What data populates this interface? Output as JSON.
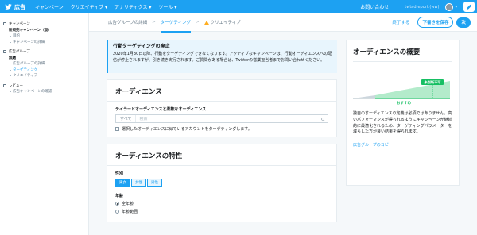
{
  "topnav": {
    "brand": "広告",
    "items": [
      "キャンペーン",
      "クリエイティブ ▾",
      "アナリティクス ▾",
      "ツール ▾"
    ],
    "contact": "お問い合わせ",
    "account": "twtadreport (ww)",
    "caret": "▾"
  },
  "sidebar": {
    "campaign_section": "キャンペーン",
    "campaign_name": "新規売キャンペーン（仮）",
    "campaign_subs": [
      "目的",
      "キャンペーンの詳細"
    ],
    "adgroup_section": "広告グループ",
    "adgroup_name": "無題",
    "adgroup_subs": [
      "広告グループの詳細",
      "ターゲティング",
      "クリエイティブ"
    ],
    "review_section": "レビュー",
    "review_sub": "広告キャンペーンの確認"
  },
  "header": {
    "breadcrumb": "広告グループの詳細",
    "sep": ">",
    "tab_active": "ターゲティング",
    "tab_warn": "クリエイティブ",
    "cancel": "終了する",
    "save": "下書きを保存",
    "next": "次"
  },
  "notice": {
    "title": "行動ターゲティングの廃止",
    "body": "2020年1月30日以降、行動をターゲティングできなくなります。アクティブなキャンペーンは、行動オーディエンスへの配信が停止されますが、引き続き実行されます。ご質問がある場合は、Twitterの営業担当者までお問い合わせください。"
  },
  "audience_card": {
    "title": "オーディエンス",
    "field_label": "テイラードオーディエンスと柔軟なオーディエンス",
    "search_category": "すべて",
    "search_placeholder": "検索",
    "checkbox_label": "選択したオーディエンスに似ているアカウントをターゲティングします。"
  },
  "traits_card": {
    "title": "オーディエンスの特性",
    "gender_label": "性別",
    "gender_options": [
      "男女",
      "女性",
      "男性"
    ],
    "age_label": "年齢",
    "age_options": [
      "全年齢",
      "年齢範囲"
    ]
  },
  "audience_panel": {
    "title": "オーディエンスの概要",
    "marker_label": "未判断不可",
    "recommend_label": "おすすめ",
    "description": "独自のオーディエンスの定義は必須ではありません。高いパフォーマンスが得られるようにキャンペーンが継続的に最適化されるため、ターゲティングパラメーターを減らした方が良い結果を得られます。",
    "copy_link": "広告グループのコピー"
  },
  "colors": {
    "brand_blue": "#1da1f2",
    "green": "#17bf63",
    "warning": "#ffad1f"
  }
}
